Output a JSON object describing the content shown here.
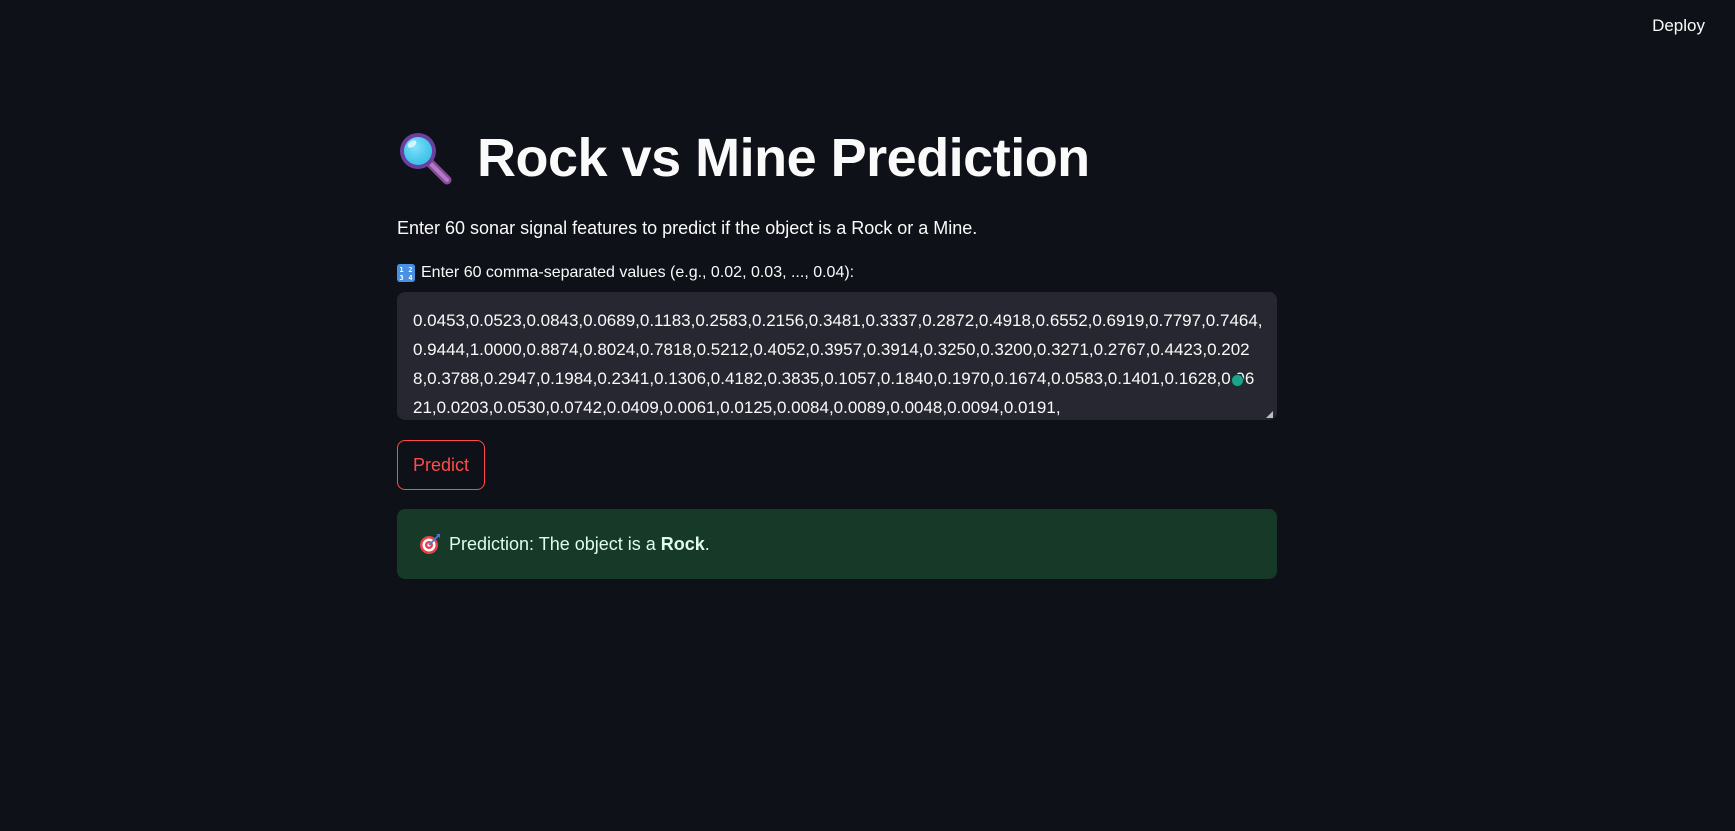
{
  "header": {
    "deploy_label": "Deploy"
  },
  "main": {
    "title": "Rock vs Mine Prediction",
    "title_icon": "magnifying-glass-icon",
    "subtitle": "Enter 60 sonar signal features to predict if the object is a Rock or a Mine.",
    "input_label": "Enter 60 comma-separated values (e.g., 0.02, 0.03, ..., 0.04):",
    "input_label_icon": "numbers-icon",
    "input_value": "0.0453,0.0523,0.0843,0.0689,0.1183,0.2583,0.2156,0.3481,0.3337,0.2872,0.4918,0.6552,0.6919,0.7797,0.7464,0.9444,1.0000,0.8874,0.8024,0.7818,0.5212,0.4052,0.3957,0.3914,0.3250,0.3200,0.3271,0.2767,0.4423,0.2028,0.3788,0.2947,0.1984,0.2341,0.1306,0.4182,0.3835,0.1057,0.1840,0.1970,0.1674,0.0583,0.1401,0.1628,0.0621,0.0203,0.0530,0.0742,0.0409,0.0061,0.0125,0.0084,0.0089,0.0048,0.0094,0.0191,",
    "predict_label": "Predict",
    "result_icon": "target-icon",
    "result_prefix": "Prediction: The object is a ",
    "result_value": "Rock",
    "result_suffix": "."
  },
  "colors": {
    "background": "#0e1117",
    "input_background": "#262730",
    "accent": "#ff4b4b",
    "success_background": "#173928",
    "success_text": "#dffde9"
  }
}
